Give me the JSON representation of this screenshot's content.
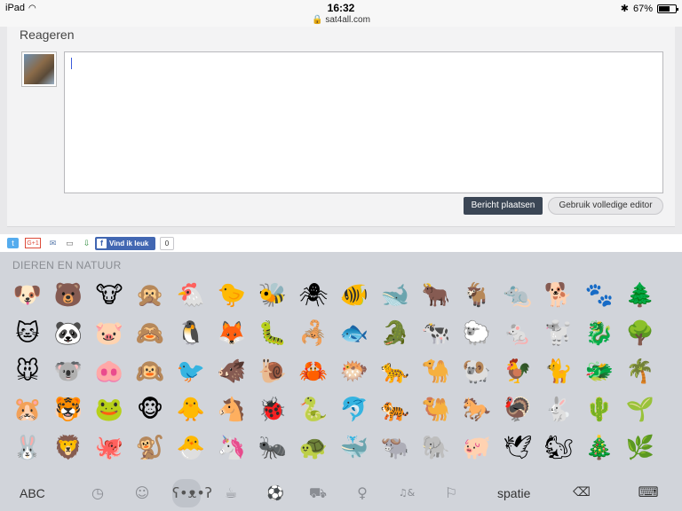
{
  "status_bar": {
    "device": "iPad",
    "time": "16:32",
    "url": "sat4all.com",
    "battery": "67%",
    "battery_level": 0.67
  },
  "comment_panel": {
    "title": "Reageren",
    "post_button": "Bericht plaatsen",
    "editor_button": "Gebruik volledige editor"
  },
  "share": {
    "like_label": "Vind ik leuk",
    "like_count": "0",
    "icons": [
      "twitter-icon",
      "google-plus-icon",
      "email-icon",
      "print-icon",
      "download-icon"
    ]
  },
  "keyboard": {
    "category_title": "DIEREN EN NATUUR",
    "abc_label": "ABC",
    "space_label": "spatie",
    "emojis": [
      "🐶",
      "🐻",
      "🐮",
      "🙊",
      "🐔",
      "🐤",
      "🐝",
      "🕷",
      "🐠",
      "🐋",
      "🐂",
      "🐐",
      "🐀",
      "🐕",
      "🐾",
      "🌲",
      "🐱",
      "🐼",
      "🐷",
      "🙈",
      "🐧",
      "🦊",
      "🐛",
      "🦂",
      "🐟",
      "🐊",
      "🐄",
      "🐑",
      "🐁",
      "🐩",
      "🐉",
      "🌳",
      "🐭",
      "🐨",
      "🐽",
      "🙉",
      "🐦",
      "🐗",
      "🐌",
      "🦀",
      "🐡",
      "🐆",
      "🐪",
      "🐏",
      "🐓",
      "🐈",
      "🐲",
      "🌴",
      "🐹",
      "🐯",
      "🐸",
      "🐵",
      "🐥",
      "🐴",
      "🐞",
      "🐍",
      "🐬",
      "🐅",
      "🐫",
      "🐎",
      "🦃",
      "🐇",
      "🌵",
      "🌱",
      "🐰",
      "🦁",
      "🐙",
      "🐒",
      "🐣",
      "🦄",
      "🐜",
      "🐢",
      "🐳",
      "🐃",
      "🐘",
      "🐖",
      "🕊",
      "🐿",
      "🎄",
      "🌿"
    ],
    "category_icons": [
      "recent-icon",
      "smiley-icon",
      "animal-icon",
      "food-icon",
      "sport-icon",
      "travel-icon",
      "object-icon",
      "symbol-icon",
      "flag-icon"
    ]
  }
}
